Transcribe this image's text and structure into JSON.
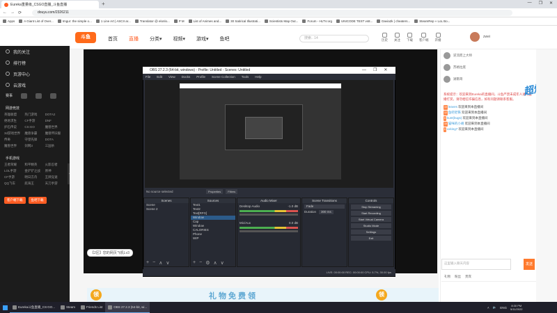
{
  "browser": {
    "tab_title": "Eureka重量级_CSGO直播_斗鱼直播",
    "new_tab": "+",
    "url": "douyu.com/2326211",
    "window_controls": [
      "—",
      "❐",
      "✕"
    ],
    "bookmarks": [
      "Apps",
      "A Giant List of Over...",
      "Imgur: the simple o...",
      "1 Line Art | ASCII ar...",
      "Translator @ elonlo...",
      "P M",
      "List of Animes and...",
      "30 Satirical Illustrati...",
      "Scientists Map Out...",
      "Forum - HLTV.org",
      "UNICODE TEST vs8...",
      "Davia2k | cheaters...",
      "SteamRep » LoL Bo..."
    ]
  },
  "site": {
    "logo": "斗鱼",
    "nav": [
      {
        "label": "首页",
        "active": false
      },
      {
        "label": "直播",
        "active": true
      },
      {
        "label": "分类▾",
        "active": false
      },
      {
        "label": "视频▾",
        "active": false
      },
      {
        "label": "游戏▾",
        "active": false
      },
      {
        "label": "鱼吧",
        "active": false
      }
    ],
    "search_placeholder": "搜索.. 14",
    "header_icons": [
      "历史",
      "关注",
      "下载",
      "客户端",
      "开播"
    ],
    "username": "zwei"
  },
  "sidebar": {
    "main": [
      "我的关注",
      "排行榜",
      "页游中心",
      "云游戏"
    ],
    "icon_row_label": "赛事",
    "section_hot": "网游竞技",
    "hot_items": [
      "英雄联盟",
      "热门游戏",
      "DOTA2",
      "绝地求生",
      "CF手游",
      "DNF",
      "炉石传说",
      "CS:GO",
      "魔兽世界",
      "3d游戏世界",
      "魔兽争霸",
      "魔兽怀旧服",
      "传奇",
      "守望先锋",
      "DOTA",
      "魔兽世界",
      "剑网3",
      "三国杀"
    ],
    "section_mobile": "手机游戏",
    "mobile_items": [
      "王者荣耀",
      "和平精英",
      "火影忍者",
      "LOL手游",
      "金铲铲之战",
      "原神",
      "CF手游",
      "明日方舟",
      "王牌竞速",
      "QQ飞车",
      "航海王",
      "天刀手游"
    ],
    "buttons": [
      "客户端下载",
      "鱼吧下载"
    ]
  },
  "room": {
    "tags": "【2区】您的网页飞机Lv3",
    "banner_text": "礼物免费领",
    "ling": "领"
  },
  "obs": {
    "title": "OBS 27.2.3 (64-bit, windows) - Profile: Untitled - Scenes: Untitled",
    "menu": [
      "File",
      "Edit",
      "View",
      "Docks",
      "Profile",
      "Scene Collection",
      "Tools",
      "Help"
    ],
    "source_bar": "No source selected",
    "source_buttons": [
      "Properties",
      "Filters"
    ],
    "docks": {
      "scenes": {
        "title": "Scenes",
        "items": [
          "Scene",
          "Scene 2"
        ]
      },
      "sources": {
        "title": "Sources",
        "items": [
          "Text1",
          "Text2",
          "Text[RFG]",
          "Window",
          "Cap",
          "Window",
          "CALORIES",
          "Phone",
          "WIP"
        ]
      },
      "mixer": {
        "title": "Audio Mixer",
        "tracks": [
          {
            "name": "Desktop Audio",
            "db": "-1.0 dB"
          },
          {
            "name": "Mic/Aux",
            "db": "0.0 dB"
          }
        ]
      },
      "transitions": {
        "title": "Scene Transitions",
        "type": "Fade",
        "duration_label": "Duration",
        "duration": "300 ms"
      },
      "controls": {
        "title": "Controls",
        "buttons": [
          "Stop Streaming",
          "Start Recording",
          "Start Virtual Camera",
          "Studio Mode",
          "Settings",
          "Exit"
        ]
      }
    },
    "status": "LIVE: 00:00:00   REC: 00:00:00   CPU: 5.7%, 30.00 fps"
  },
  "chat": {
    "ranks": [
      "逆流而上大师",
      "苏格拉底",
      "湖南哥"
    ],
    "system_msg": "系统提示：欢迎来到Eureka的直播间，斗鱼严禁未成年人进行直播打赏，请勿相信诈骗信息，如有问题请联系客服。",
    "messages": [
      {
        "lv": "10",
        "name": "leaves",
        "text": "欢迎来到本直播间"
      },
      {
        "lv": "12",
        "name": "鱼吧老铁",
        "text": "欢迎来到本直播间"
      },
      {
        "lv": "8",
        "name": "kunt(bugs)",
        "text": "欢迎来到本直播间"
      },
      {
        "lv": "15",
        "name": "猫咪的小胡",
        "text": "欢迎来到本直播间"
      },
      {
        "lv": "6",
        "name": "xxking7",
        "text": "欢迎来到本直播间"
      }
    ],
    "input_placeholder": "这里输入聊天内容",
    "send": "发送",
    "tabs": [
      "礼物",
      "粉丝",
      "贵宾"
    ],
    "float_badge": "超燃"
  },
  "taskbar": {
    "apps": [
      {
        "label": "Eureka斗鱼直播_CS:GO...",
        "active": false
      },
      {
        "label": "Steam",
        "active": false
      },
      {
        "label": "Friends List",
        "active": false
      },
      {
        "label": "OBS 27.2.3 (64-bit, wi...",
        "active": true
      }
    ],
    "lang": "ENG",
    "time": "8:30 PM",
    "date": "5/11/2022"
  }
}
